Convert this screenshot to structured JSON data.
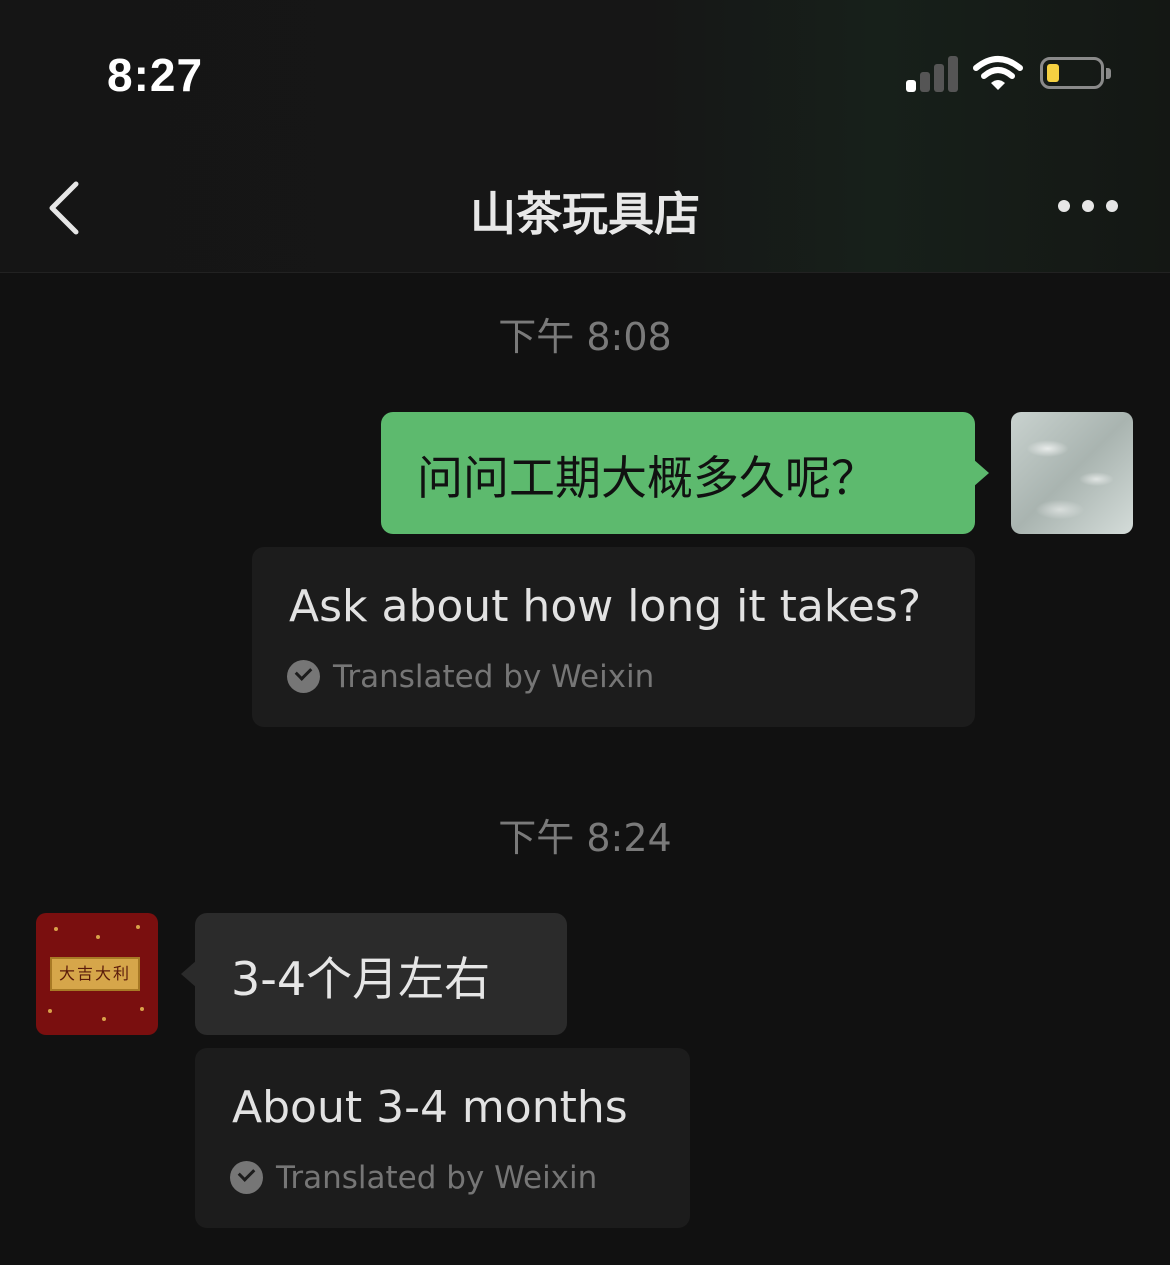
{
  "status_bar": {
    "time": "8:27"
  },
  "header": {
    "title": "山茶玩具店"
  },
  "messages": [
    {
      "timestamp": "下午 8:08"
    },
    {
      "sender": "me",
      "text": "问问工期大概多久呢？",
      "translation": "Ask about how long it takes?",
      "translation_credit": "Translated by Weixin"
    },
    {
      "timestamp": "下午 8:24"
    },
    {
      "sender": "other",
      "avatar_text": "大吉大利",
      "text": "3-4个月左右",
      "translation": "About 3-4 months",
      "translation_credit": "Translated by Weixin"
    }
  ],
  "colors": {
    "outgoing_bubble": "#5dba6e",
    "incoming_bubble": "#2b2b2b",
    "background": "#111111"
  }
}
